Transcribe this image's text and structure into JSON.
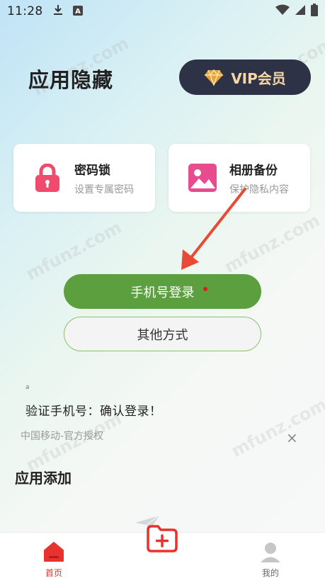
{
  "status_bar": {
    "time": "11:28",
    "icons": [
      "download-icon",
      "a-app-icon",
      "wifi-icon",
      "signal-icon",
      "battery-icon"
    ]
  },
  "header": {
    "title": "应用隐藏",
    "vip_label": "VIP会员"
  },
  "cards": [
    {
      "title": "密码锁",
      "subtitle": "设置专属密码",
      "icon": "lock-icon",
      "color": "#ef4c6d"
    },
    {
      "title": "相册备份",
      "subtitle": "保护隐私内容",
      "icon": "image-icon",
      "color": "#e94c8e"
    }
  ],
  "login": {
    "primary_label": "手机号登录",
    "secondary_label": "其他方式",
    "verify_text": "验证手机号：确认登录！",
    "auth_text": "中国移动-官方授权",
    "small_mark": "a",
    "close_symbol": "×"
  },
  "section": {
    "title": "应用添加"
  },
  "tabbar": {
    "home_label": "首页",
    "me_label": "我的"
  },
  "watermark": "mfunz.com",
  "colors": {
    "accent_green": "#5c9f3f",
    "accent_red": "#e8322e",
    "vip_bg": "#2e3246",
    "vip_text": "#f6d6a6"
  }
}
